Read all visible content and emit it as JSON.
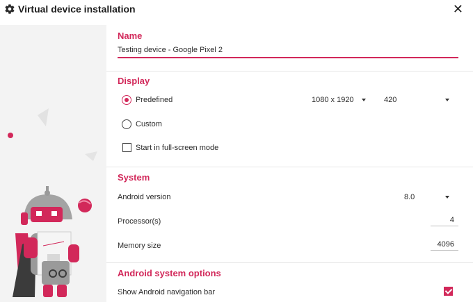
{
  "window": {
    "title": "Virtual device installation",
    "close_label": "✕",
    "icon": "gear-icon"
  },
  "name_section": {
    "title": "Name",
    "value": "Testing device - Google Pixel 2"
  },
  "display_section": {
    "title": "Display",
    "predefined_label": "Predefined",
    "custom_label": "Custom",
    "fullscreen_label": "Start in full-screen mode",
    "resolution": "1080 x 1920",
    "dpi": "420",
    "selected_mode": "Predefined",
    "fullscreen_checked": false
  },
  "system_section": {
    "title": "System",
    "android_version_label": "Android version",
    "android_version": "8.0",
    "processors_label": "Processor(s)",
    "processors": "4",
    "memory_label": "Memory size",
    "memory": "4096"
  },
  "android_options_section": {
    "title": "Android system options",
    "nav_bar_label": "Show Android navigation bar",
    "nav_bar_checked": true
  },
  "colors": {
    "accent": "#d2285a",
    "sidebar_bg": "#f3f3f3"
  }
}
